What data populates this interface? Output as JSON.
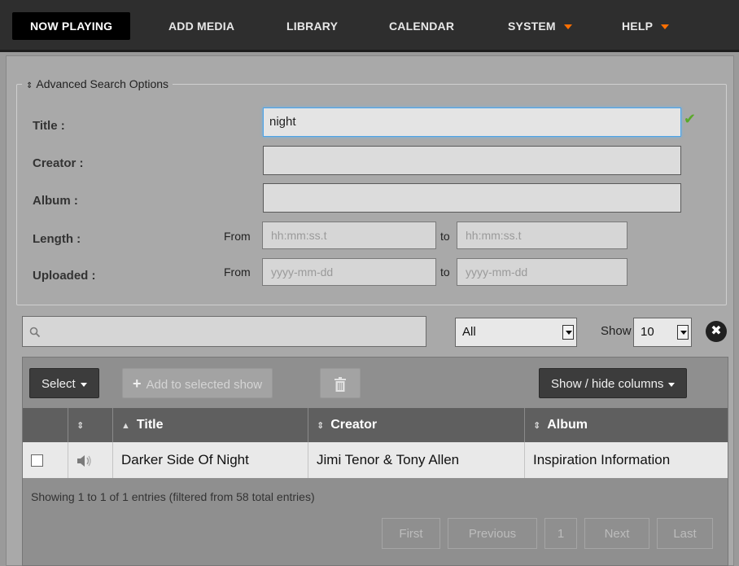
{
  "nav": {
    "items": [
      {
        "label": "NOW PLAYING",
        "active": true
      },
      {
        "label": "ADD MEDIA"
      },
      {
        "label": "LIBRARY"
      },
      {
        "label": "CALENDAR"
      },
      {
        "label": "SYSTEM",
        "dropdown": true
      },
      {
        "label": "HELP",
        "dropdown": true
      }
    ]
  },
  "advanced_search": {
    "legend": "Advanced Search Options",
    "title_label": "Title :",
    "title_value": "night",
    "creator_label": "Creator :",
    "creator_value": "",
    "album_label": "Album :",
    "album_value": "",
    "length_label": "Length :",
    "uploaded_label": "Uploaded :",
    "from_label": "From",
    "to_label": "to",
    "length_placeholder": "hh:mm:ss.t",
    "uploaded_placeholder": "yyyy-mm-dd"
  },
  "filter": {
    "type_selected": "All",
    "show_label": "Show",
    "show_count": "10"
  },
  "toolbar": {
    "select_label": "Select",
    "add_label": "Add to selected show",
    "columns_label": "Show / hide columns"
  },
  "table": {
    "columns": [
      "",
      "",
      "Title",
      "Creator",
      "Album"
    ],
    "rows": [
      {
        "title": "Darker Side Of Night",
        "creator": "Jimi Tenor & Tony Allen",
        "album": "Inspiration Information"
      }
    ],
    "info": "Showing 1 to 1 of 1 entries (filtered from 58 total entries)"
  },
  "pagination": {
    "first": "First",
    "previous": "Previous",
    "page": "1",
    "next": "Next",
    "last": "Last"
  },
  "colors": {
    "accent": "#ff6f01",
    "nav_bg": "#2e2e2e",
    "focus": "#4da3e6",
    "valid": "#5aa92a"
  }
}
